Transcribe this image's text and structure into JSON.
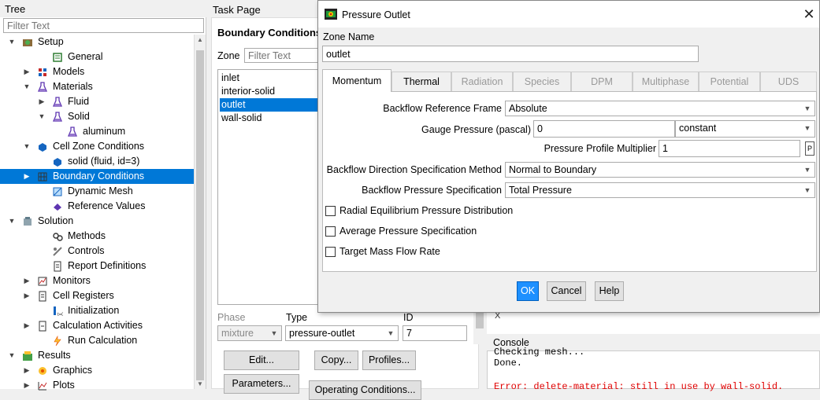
{
  "tree": {
    "header": "Tree",
    "filter_placeholder": "Filter Text",
    "items": [
      {
        "label": "Setup",
        "twisty": "▼"
      },
      {
        "label": "General"
      },
      {
        "label": "Models",
        "twisty": "▶"
      },
      {
        "label": "Materials",
        "twisty": "▼"
      },
      {
        "label": "Fluid",
        "twisty": "▶"
      },
      {
        "label": "Solid",
        "twisty": "▼"
      },
      {
        "label": "aluminum"
      },
      {
        "label": "Cell Zone Conditions",
        "twisty": "▼"
      },
      {
        "label": "solid (fluid, id=3)"
      },
      {
        "label": "Boundary Conditions",
        "twisty": "▶"
      },
      {
        "label": "Dynamic Mesh"
      },
      {
        "label": "Reference Values"
      },
      {
        "label": "Solution",
        "twisty": "▼"
      },
      {
        "label": "Methods"
      },
      {
        "label": "Controls"
      },
      {
        "label": "Report Definitions"
      },
      {
        "label": "Monitors",
        "twisty": "▶"
      },
      {
        "label": "Cell Registers",
        "twisty": "▶"
      },
      {
        "label": "Initialization"
      },
      {
        "label": "Calculation Activities",
        "twisty": "▶"
      },
      {
        "label": "Run Calculation"
      },
      {
        "label": "Results",
        "twisty": "▼"
      },
      {
        "label": "Graphics",
        "twisty": "▶"
      },
      {
        "label": "Plots",
        "twisty": "▶"
      }
    ]
  },
  "task_page": {
    "title": "Task Page",
    "heading": "Boundary Conditions",
    "zone_label": "Zone",
    "zone_filter_placeholder": "Filter Text",
    "zones": [
      "inlet",
      "interior-solid",
      "outlet",
      "wall-solid"
    ],
    "selected_zone": "outlet",
    "phase_label": "Phase",
    "phase_value": "mixture",
    "type_label": "Type",
    "type_value": "pressure-outlet",
    "id_label": "ID",
    "id_value": "7",
    "buttons": {
      "edit": "Edit...",
      "copy": "Copy...",
      "profiles": "Profiles...",
      "parameters": "Parameters...",
      "operating": "Operating Conditions..."
    }
  },
  "console": {
    "title": "Console",
    "lines": [
      "Checking mesh...",
      "Done.",
      "",
      "Error: delete-material: still in use by wall-solid."
    ],
    "error_color": "#e00000"
  },
  "graphics_label": "X",
  "dialog": {
    "title": "Pressure Outlet",
    "close_glyph": "✕",
    "zone_name_label": "Zone Name",
    "zone_name_value": "outlet",
    "tabs": [
      {
        "label": "Momentum",
        "active": true,
        "enabled": true
      },
      {
        "label": "Thermal",
        "enabled": true
      },
      {
        "label": "Radiation",
        "enabled": false
      },
      {
        "label": "Species",
        "enabled": false
      },
      {
        "label": "DPM",
        "enabled": false
      },
      {
        "label": "Multiphase",
        "enabled": false
      },
      {
        "label": "Potential",
        "enabled": false
      },
      {
        "label": "UDS",
        "enabled": false
      }
    ],
    "backflow_ref_frame_label": "Backflow Reference Frame",
    "backflow_ref_frame_value": "Absolute",
    "gauge_pressure_label": "Gauge Pressure (pascal)",
    "gauge_pressure_value": "0",
    "gauge_pressure_method": "constant",
    "profile_multiplier_label": "Pressure Profile Multiplier",
    "profile_multiplier_value": "1",
    "param_glyph": "P",
    "backflow_dir_label": "Backflow Direction Specification Method",
    "backflow_dir_value": "Normal to Boundary",
    "backflow_pressure_label": "Backflow Pressure Specification",
    "backflow_pressure_value": "Total Pressure",
    "checkboxes": [
      "Radial Equilibrium Pressure Distribution",
      "Average Pressure Specification",
      "Target Mass Flow Rate"
    ],
    "buttons": {
      "ok": "OK",
      "cancel": "Cancel",
      "help": "Help"
    }
  }
}
